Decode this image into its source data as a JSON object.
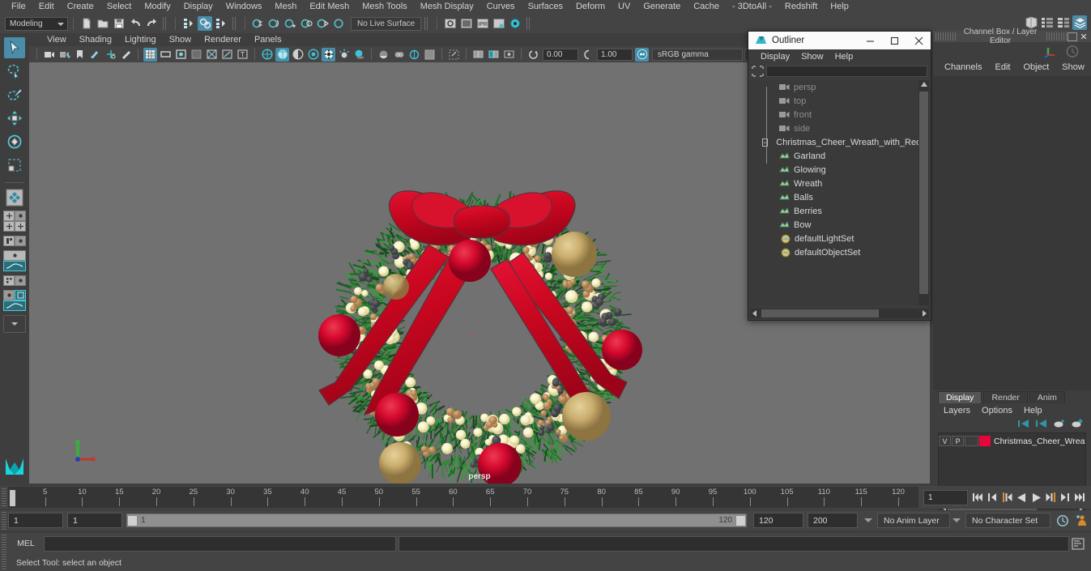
{
  "menubar": {
    "items": [
      "File",
      "Edit",
      "Create",
      "Select",
      "Modify",
      "Display",
      "Windows",
      "Mesh",
      "Edit Mesh",
      "Mesh Tools",
      "Mesh Display",
      "Curves",
      "Surfaces",
      "Deform",
      "UV",
      "Generate",
      "Cache",
      "- 3DtoAll -",
      "Redshift",
      "Help"
    ]
  },
  "statusbar": {
    "menu_set": "Modeling",
    "live_surface": "No Live Surface"
  },
  "viewport_menu": {
    "items": [
      "View",
      "Shading",
      "Lighting",
      "Show",
      "Renderer",
      "Panels"
    ]
  },
  "viewport_toolbar": {
    "exposure": "0.00",
    "gamma": "1.00",
    "color_space": "sRGB gamma"
  },
  "viewport": {
    "camera_label": "persp"
  },
  "outliner": {
    "title": "Outliner",
    "menu": [
      "Display",
      "Show",
      "Help"
    ],
    "search_value": "",
    "items": [
      {
        "label": "persp",
        "icon": "camera-icon",
        "style": "dim",
        "indent": 1
      },
      {
        "label": "top",
        "icon": "camera-icon",
        "style": "dim",
        "indent": 1
      },
      {
        "label": "front",
        "icon": "camera-icon",
        "style": "dim",
        "indent": 1
      },
      {
        "label": "side",
        "icon": "camera-icon",
        "style": "dim",
        "indent": 1
      },
      {
        "label": "Christmas_Cheer_Wreath_with_Red_",
        "icon": "group-icon",
        "style": "norm",
        "indent": 0
      },
      {
        "label": "Garland",
        "icon": "mesh-icon",
        "style": "norm",
        "indent": 2
      },
      {
        "label": "Glowing",
        "icon": "mesh-icon",
        "style": "norm",
        "indent": 2
      },
      {
        "label": "Wreath",
        "icon": "mesh-icon",
        "style": "norm",
        "indent": 2
      },
      {
        "label": "Balls",
        "icon": "mesh-icon",
        "style": "norm",
        "indent": 2
      },
      {
        "label": "Berries",
        "icon": "mesh-icon",
        "style": "norm",
        "indent": 2
      },
      {
        "label": "Bow",
        "icon": "mesh-icon",
        "style": "norm",
        "indent": 2
      },
      {
        "label": "defaultLightSet",
        "icon": "set-icon",
        "style": "norm",
        "indent": 1
      },
      {
        "label": "defaultObjectSet",
        "icon": "set-icon",
        "style": "norm",
        "indent": 1
      }
    ]
  },
  "right_panel": {
    "title": "Channel Box / Layer Editor",
    "menu": [
      "Channels",
      "Edit",
      "Object",
      "Show"
    ]
  },
  "layer_editor": {
    "tabs": [
      "Display",
      "Render",
      "Anim"
    ],
    "selected_tab": "Display",
    "menu": [
      "Layers",
      "Options",
      "Help"
    ],
    "rows": [
      {
        "visibility": "V",
        "playback": "P",
        "color": "#e8053a",
        "name": "Christmas_Cheer_Wreath"
      }
    ]
  },
  "timeslider": {
    "ticks": [
      5,
      10,
      15,
      20,
      25,
      30,
      35,
      40,
      45,
      50,
      55,
      60,
      65,
      70,
      75,
      80,
      85,
      90,
      95,
      100,
      105,
      110,
      115,
      120
    ],
    "start": 1,
    "end": 120,
    "current_frame": "1"
  },
  "rangebar": {
    "anim_start": "1",
    "range_start": "1",
    "slider_start": "1",
    "slider_end": "120",
    "range_end": "120",
    "anim_end": "200",
    "anim_layer": "No Anim Layer",
    "character_set": "No Character Set"
  },
  "command_line": {
    "language_label": "MEL",
    "value": ""
  },
  "help_line": {
    "text": "Select Tool: select an object"
  },
  "colors": {
    "accent": "#4b8ca8",
    "panel_bg": "#3e3e3e",
    "viewport_bg": "#717171",
    "layer_swatch": "#e8053a"
  }
}
